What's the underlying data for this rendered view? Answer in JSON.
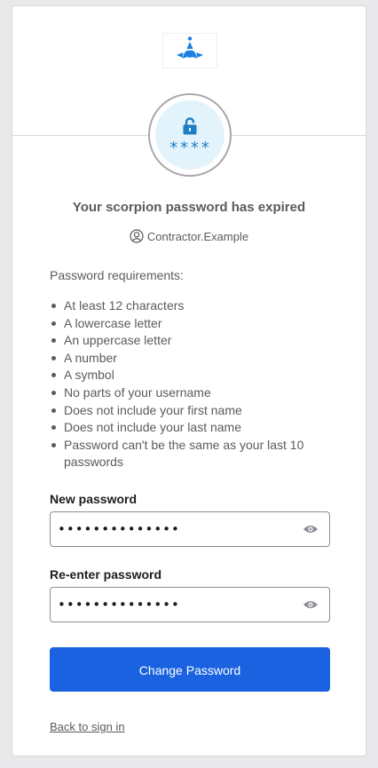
{
  "header": {
    "logo": "scorpion-logo",
    "badge_icon": "unlocked-padlock-icon",
    "badge_stars": "****"
  },
  "title": "Your scorpion password has expired",
  "user": {
    "icon": "user-circle-icon",
    "name": "Contractor.Example"
  },
  "requirements": {
    "label": "Password requirements:",
    "items": [
      "At least 12 characters",
      "A lowercase letter",
      "An uppercase letter",
      "A number",
      "A symbol",
      "No parts of your username",
      "Does not include your first name",
      "Does not include your last name",
      "Password can't be the same as your last 10 passwords"
    ]
  },
  "fields": {
    "new_password": {
      "label": "New password",
      "value": "••••••••••••••",
      "icon": "eye-icon"
    },
    "reenter_password": {
      "label": "Re-enter password",
      "value": "••••••••••••••",
      "icon": "eye-icon"
    }
  },
  "actions": {
    "submit_label": "Change Password",
    "back_link": "Back to sign in"
  },
  "colors": {
    "primary": "#1a62e0",
    "brand": "#1a7fe0",
    "badge_background": "#e3f3fc",
    "text": "#5b5b5f"
  }
}
